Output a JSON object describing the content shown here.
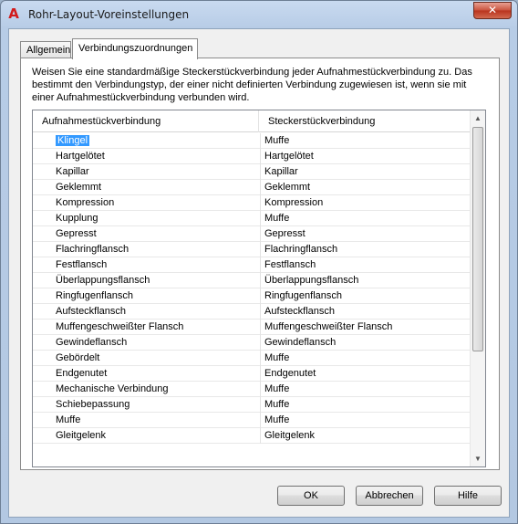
{
  "window": {
    "title": "Rohr-Layout-Voreinstellungen",
    "app_icon": "A",
    "close_glyph": "✕"
  },
  "tabs": [
    {
      "label": "Allgemein",
      "active": false
    },
    {
      "label": "Verbindungszuordnungen",
      "active": true
    }
  ],
  "description": "Weisen Sie eine standardmäßige Steckerstückverbindung jeder Aufnahmestückverbindung zu. Das bestimmt den Verbindungstyp, der einer nicht definierten Verbindung zugewiesen ist, wenn sie mit einer Aufnahmestückverbindung verbunden wird.",
  "grid": {
    "columns": [
      "Aufnahmestückverbindung",
      "Steckerstückverbindung"
    ],
    "selected_row": 0,
    "rows": [
      [
        "Klingel",
        "Muffe"
      ],
      [
        "Hartgelötet",
        "Hartgelötet"
      ],
      [
        "Kapillar",
        "Kapillar"
      ],
      [
        "Geklemmt",
        "Geklemmt"
      ],
      [
        "Kompression",
        "Kompression"
      ],
      [
        "Kupplung",
        "Muffe"
      ],
      [
        "Gepresst",
        "Gepresst"
      ],
      [
        "Flachringflansch",
        "Flachringflansch"
      ],
      [
        "Festflansch",
        "Festflansch"
      ],
      [
        "Überlappungsflansch",
        "Überlappungsflansch"
      ],
      [
        "Ringfugenflansch",
        "Ringfugenflansch"
      ],
      [
        "Aufsteckflansch",
        "Aufsteckflansch"
      ],
      [
        "Muffengeschweißter Flansch",
        "Muffengeschweißter Flansch"
      ],
      [
        "Gewindeflansch",
        "Gewindeflansch"
      ],
      [
        "Gebördelt",
        "Muffe"
      ],
      [
        "Endgenutet",
        "Endgenutet"
      ],
      [
        "Mechanische Verbindung",
        "Muffe"
      ],
      [
        "Schiebepassung",
        "Muffe"
      ],
      [
        "Muffe",
        "Muffe"
      ],
      [
        "Gleitgelenk",
        "Gleitgelenk"
      ]
    ]
  },
  "scrollbar": {
    "up_glyph": "▲",
    "down_glyph": "▼"
  },
  "buttons": {
    "ok": "OK",
    "cancel": "Abbrechen",
    "help": "Hilfe"
  }
}
